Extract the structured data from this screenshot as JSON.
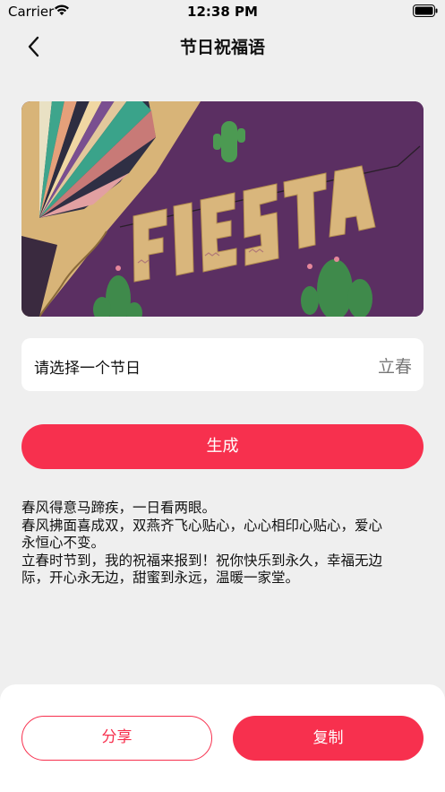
{
  "status_bar": {
    "carrier": "Carrier",
    "time": "12:38 PM",
    "wifi_icon": "wifi-icon",
    "battery_icon": "battery-icon"
  },
  "nav": {
    "back_icon": "chevron-left-icon",
    "title": "节日祝福语"
  },
  "banner": {
    "image": "fiesta-banner-image",
    "text": "FIESTA",
    "colors": {
      "background": "#5b2f62",
      "paper": "#d9b67c"
    }
  },
  "festival_picker": {
    "prompt": "请选择一个节日",
    "value": "立春"
  },
  "generate_button": {
    "label": "生成"
  },
  "blessing": {
    "lines": [
      "春风得意马蹄疾，一日看两眼。",
      "春风拂面喜成双，双燕齐飞心贴心，心心相印心贴心，爱心",
      "永恒心不变。",
      "立春时节到，我的祝福来报到！祝你快乐到永久，幸福无边",
      "际，开心永无边，甜蜜到永远，温暖一家堂。"
    ]
  },
  "actions": {
    "share_label": "分享",
    "copy_label": "复制"
  },
  "theme": {
    "accent": "#f7304e",
    "background": "#efefef",
    "card": "#ffffff"
  }
}
